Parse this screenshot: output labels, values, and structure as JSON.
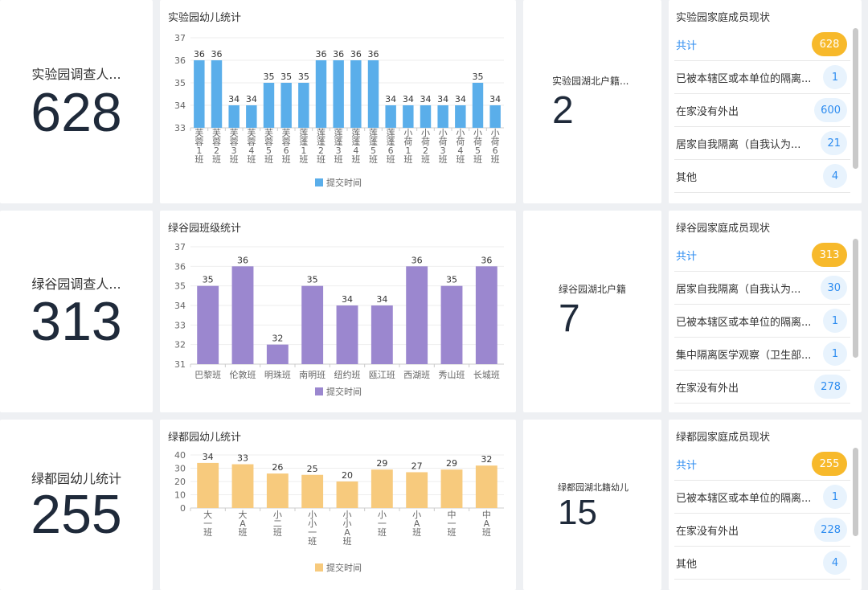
{
  "rows": [
    {
      "stat": {
        "label": "实验园调查人...",
        "value": "628"
      },
      "chart_title": "实验园幼儿统计",
      "mid": {
        "label": "实验园湖北户籍...",
        "value": "2"
      },
      "list": {
        "title": "实验园家庭成员现状",
        "items": [
          {
            "name": "共计",
            "value": "628"
          },
          {
            "name": "已被本辖区或本单位的隔离...",
            "value": "1"
          },
          {
            "name": "在家没有外出",
            "value": "600"
          },
          {
            "name": "居家自我隔离（自我认为...",
            "value": "21"
          },
          {
            "name": "其他",
            "value": "4"
          }
        ]
      }
    },
    {
      "stat": {
        "label": "绿谷园调查人...",
        "value": "313"
      },
      "chart_title": "绿谷园班级统计",
      "mid": {
        "label": "绿谷园湖北户籍",
        "value": "7"
      },
      "list": {
        "title": "绿谷园家庭成员现状",
        "items": [
          {
            "name": "共计",
            "value": "313"
          },
          {
            "name": "居家自我隔离（自我认为...",
            "value": "30"
          },
          {
            "name": "已被本辖区或本单位的隔离...",
            "value": "1"
          },
          {
            "name": "集中隔离医学观察（卫生部...",
            "value": "1"
          },
          {
            "name": "在家没有外出",
            "value": "278"
          }
        ]
      }
    },
    {
      "stat": {
        "label": "绿都园幼儿统计",
        "value": "255"
      },
      "chart_title": "绿都园幼儿统计",
      "mid": {
        "label": "绿都园湖北籍幼儿",
        "value": "15"
      },
      "list": {
        "title": "绿都园家庭成员现状",
        "items": [
          {
            "name": "共计",
            "value": "255"
          },
          {
            "name": "已被本辖区或本单位的隔离...",
            "value": "1"
          },
          {
            "name": "在家没有外出",
            "value": "228"
          },
          {
            "name": "其他",
            "value": "4"
          }
        ]
      }
    }
  ],
  "colors": {
    "blue": "#5aaeea",
    "purple": "#9b87cf",
    "orange": "#f7ca7d",
    "accent": "#2d8cf0",
    "badge_total": "#f7b92b"
  },
  "chart_data": [
    {
      "type": "bar",
      "title": "实验园幼儿统计",
      "categories": [
        "芙蓉1班",
        "芙蓉2班",
        "芙蓉3班",
        "芙蓉4班",
        "芙蓉5班",
        "芙蓉6班",
        "莲蓬1班",
        "莲蓬2班",
        "莲蓬3班",
        "莲蓬4班",
        "莲蓬5班",
        "莲蓬6班",
        "小荷1班",
        "小荷2班",
        "小荷3班",
        "小荷4班",
        "小荷5班",
        "小荷6班"
      ],
      "series": [
        {
          "name": "提交时间",
          "values": [
            36,
            36,
            34,
            34,
            35,
            35,
            35,
            36,
            36,
            36,
            36,
            34,
            34,
            34,
            34,
            34,
            35,
            34
          ]
        }
      ],
      "yticks": [
        33,
        34,
        35,
        36,
        37
      ],
      "ylim": [
        33,
        37
      ],
      "legend": "bottom",
      "color": "#5aaeea",
      "vertical_labels": true
    },
    {
      "type": "bar",
      "title": "绿谷园班级统计",
      "categories": [
        "巴黎班",
        "伦敦班",
        "明珠班",
        "南明班",
        "纽约班",
        "瓯江班",
        "西湖班",
        "秀山班",
        "长城班"
      ],
      "series": [
        {
          "name": "提交时间",
          "values": [
            35,
            36,
            32,
            35,
            34,
            34,
            36,
            35,
            36
          ]
        }
      ],
      "yticks": [
        31,
        32,
        33,
        34,
        35,
        36,
        37
      ],
      "ylim": [
        31,
        37
      ],
      "legend": "bottom",
      "color": "#9b87cf",
      "vertical_labels": false
    },
    {
      "type": "bar",
      "title": "绿都园幼儿统计",
      "categories": [
        "大一班",
        "大A班",
        "小二班",
        "小小一班",
        "小小A班",
        "小一班",
        "小A班",
        "中一班",
        "中A班"
      ],
      "series": [
        {
          "name": "提交时间",
          "values": [
            34,
            33,
            26,
            25,
            20,
            29,
            27,
            29,
            32
          ]
        }
      ],
      "yticks": [
        0,
        10,
        20,
        30,
        40
      ],
      "ylim": [
        0,
        40
      ],
      "legend": "bottom",
      "color": "#f7ca7d",
      "vertical_labels": true
    }
  ]
}
